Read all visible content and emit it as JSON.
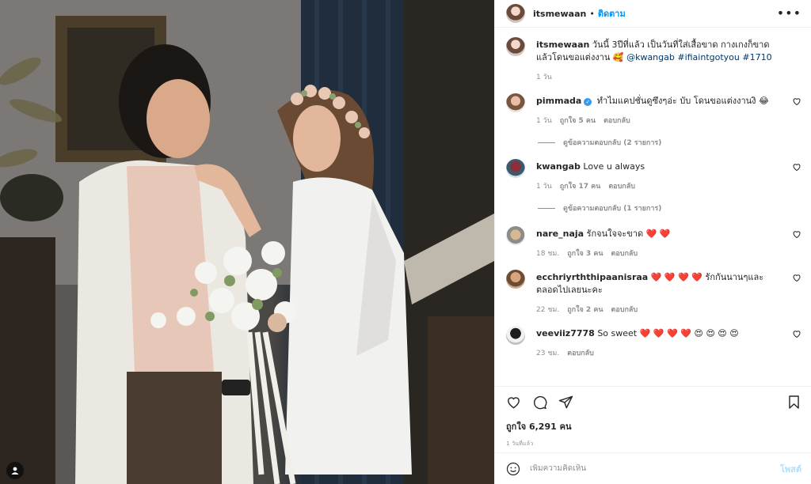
{
  "post": {
    "author": "itsmewaan",
    "follow_label": "ติดตาม",
    "more_label": "•••",
    "caption_text": "วันนี้ 3ปีที่แล้ว เป็นวันที่ใส่เสื้อขาด กางเกงก็ขาด แล้วโดนขอแต่งงาน 🥰 ",
    "caption_mention": "@kwangab #ifiaintgotyou #1710",
    "caption_time": "1 วัน"
  },
  "comments": [
    {
      "user": "pimmada",
      "verified": true,
      "text": "ทำไมแคปชั่นดูซึงๆอ่ะ บับ โดนขอแต่งงานงิ 😂",
      "time": "1 วัน",
      "likes": "ถูกใจ 5 คน",
      "reply": "ตอบกลับ",
      "view_replies": "ดูข้อความตอบกลับ (2 รายการ)"
    },
    {
      "user": "kwangab",
      "text": "Love u always",
      "time": "1 วัน",
      "likes": "ถูกใจ 17 คน",
      "reply": "ตอบกลับ",
      "view_replies": "ดูข้อความตอบกลับ (1 รายการ)"
    },
    {
      "user": "nare_naja",
      "text": "รักจนใจจะขาด ❤️ ❤️",
      "time": "18 ชม.",
      "likes": "ถูกใจ 3 คน",
      "reply": "ตอบกลับ"
    },
    {
      "user": "ecchriyrththipaanisraa",
      "text": "❤️ ❤️ ❤️ ❤️ รักกันนานๆและตลอดไปเลยนะคะ",
      "time": "22 ชม.",
      "likes": "ถูกใจ 2 คน",
      "reply": "ตอบกลับ"
    },
    {
      "user": "veeviiz7778",
      "text": "So sweet ❤️ ❤️ ❤️ ❤️ 😍 😍 😍 😍",
      "time": "23 ชม.",
      "reply": "ตอบกลับ"
    }
  ],
  "footer": {
    "likes_count": "ถูกใจ 6,291 คน",
    "posted": "1 วันที่แล้ว",
    "comment_placeholder": "เพิ่มความคิดเห็น",
    "post_label": "โพสต์"
  },
  "colors": {
    "link": "#00376b",
    "follow": "#0095f6",
    "muted": "#8e8e8e",
    "heart_red": "#ed4956"
  },
  "icons": [
    "heart-icon",
    "comment-icon",
    "share-icon",
    "bookmark-icon",
    "emoji-icon",
    "tag-user-icon",
    "more-icon",
    "verified-icon"
  ]
}
